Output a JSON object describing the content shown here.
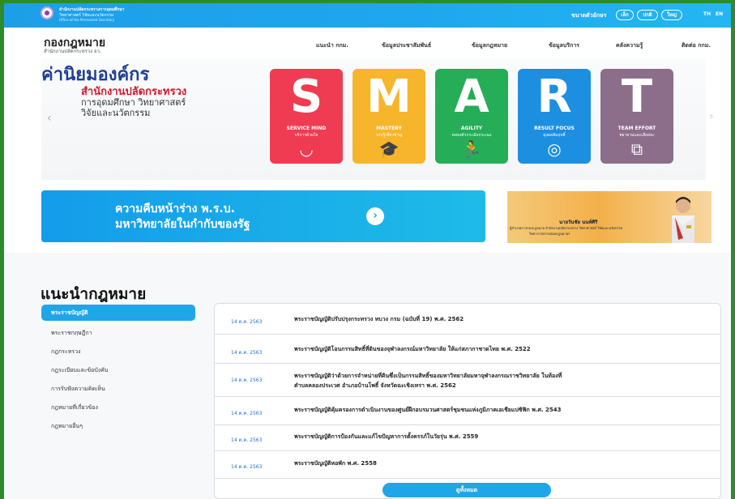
{
  "topbar": {
    "org_th": "สำนักงานปลัดกระทรวงการอุดมศึกษา",
    "org_th2": "วิทยาศาสตร์ วิจัยและนวัตกรรม",
    "org_en": "Office of the Permanent Secretary",
    "font_size_label": "ขนาดตัวอักษร",
    "font_buttons": [
      "เล็ก",
      "ปกติ",
      "ใหญ่"
    ],
    "lang_th": "TH",
    "lang_en": "EN"
  },
  "header": {
    "brand": "กองกฎหมาย",
    "brand_sub": "สำนักงานปลัดกระทรวง อว.",
    "nav": [
      "แนะนำ กกม.",
      "ข้อมูลประชาสัมพันธ์",
      "ข้อมูลกฎหมาย",
      "ข้อมูลบริการ",
      "คลังความรู้",
      "ติดต่อ กกม."
    ]
  },
  "hero": {
    "title": "ค่านิยมองค์กร",
    "line1": "สำนักงานปลัดกระทรวง",
    "line2": "การอุดมศึกษา วิทยาศาสตร์",
    "line3": "วิจัยและนวัตกรรม",
    "arrow_left": "‹",
    "arrow_right": "›",
    "cards": [
      {
        "letter": "S",
        "title": "SERVICE MIND",
        "desc": "บริการด้วยใจ",
        "color": "#ef3c52",
        "icon": "smile-icon",
        "glyph": "◡"
      },
      {
        "letter": "M",
        "title": "MASTERY",
        "desc": "รอบรู้เชี่ยวชาญ",
        "color": "#f7b52b",
        "icon": "graduation-cap-icon",
        "glyph": "🎓"
      },
      {
        "letter": "A",
        "title": "AGILITY",
        "desc": "คล่องตัวกระฉับกระเฉง",
        "color": "#25ad57",
        "icon": "runner-icon",
        "glyph": "🏃"
      },
      {
        "letter": "R",
        "title": "RESULT FOCUS",
        "desc": "มุ่งผลสัมฤทธิ์",
        "color": "#1c8fe0",
        "icon": "target-icon",
        "glyph": "◎"
      },
      {
        "letter": "T",
        "title": "TEAM EFFORT",
        "desc": "พยายามและเสียสละ",
        "color": "#8c6e8b",
        "icon": "puzzle-icon",
        "glyph": "⧉"
      }
    ]
  },
  "banner1": {
    "line1": "ความคืบหน้าร่าง พ.ร.บ.",
    "line2": "มหาวิทยาลัยในกำกับของรัฐ",
    "button": "›"
  },
  "banner2": {
    "name": "นายวันชัย นนท์ศิริ",
    "pos1": "ผู้อำนวยการกองกฎหมาย สำนักงานปลัดกระทรวง วิทยาศาสตร์ วิจัยและนวัตกรรม",
    "pos2": "วิทยาการตรวจสอบกฎหมายฯ"
  },
  "section": {
    "title": "แนะนำกฎหมาย",
    "sidebar": [
      "พระราชบัญญัติ",
      "พระราชกฤษฎีกา",
      "กฎกระทรวง",
      "กฎระเบียบและข้อบังคับ",
      "การรับฟังความคิดเห็น",
      "กฎหมายที่เกี่ยวข้อง",
      "กฎหมายอื่นๆ"
    ],
    "rows": [
      {
        "date": "14 ต.ค. 2563",
        "lines": [
          "พระราชบัญญัติปรับปรุงกระทรวง ทบวง กรม (ฉบับที่ 19) พ.ศ. 2562"
        ]
      },
      {
        "date": "14 ต.ค. 2563",
        "lines": [
          "พระราชบัญญัติโอนกรรมสิทธิ์ที่ดินของจุฬาลงกรณ์มหาวิทยาลัย ให้แก่สภากาชาดไทย พ.ศ. 2522"
        ]
      },
      {
        "date": "14 ต.ค. 2563",
        "lines": [
          "พระราชบัญญัติว่าด้วยการจำหน่ายที่ดินซึ่งเป็นกรรมสิทธิ์ของมหาวิทยาลัยมหาจุฬาลงกรณราชวิทยาลัย ในท้องที่",
          "ตำบลคลองประเวศ อำเภอบ้านโพธิ์ จังหวัดฉะเชิงเทรา พ.ศ. 2562"
        ]
      },
      {
        "date": "14 ต.ค. 2563",
        "lines": [
          "พระราชบัญญัติคุ้มครองการดำเนินงานของศูนย์ฝึกอบรมวนศาสตร์ชุมชนแห่งภูมิภาคเอเชียแปซิฟิก พ.ศ. 2543"
        ]
      },
      {
        "date": "14 ต.ค. 2563",
        "lines": [
          "พระราชบัญญัติการป้องกันและแก้ไขปัญหาการตั้งครรภ์ในวัยรุ่น พ.ศ. 2559"
        ]
      },
      {
        "date": "14 ต.ค. 2563",
        "lines": [
          "พระราชบัญญัติหอพัก พ.ศ. 2558"
        ]
      }
    ],
    "view_all": "ดูทั้งหมด"
  }
}
